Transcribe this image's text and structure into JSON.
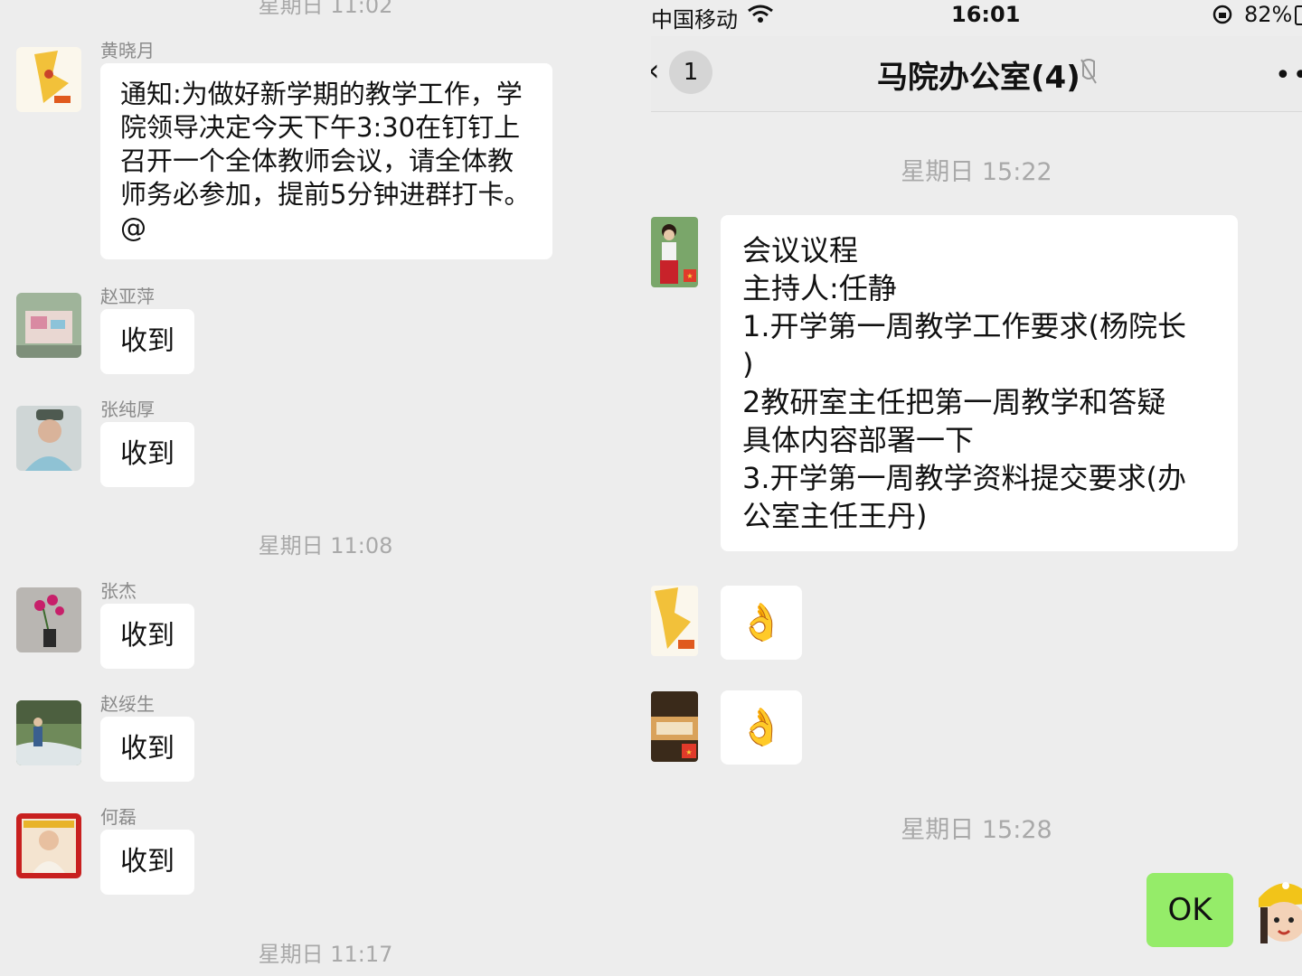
{
  "left": {
    "top_ts": "星期日 11:02",
    "messages": [
      {
        "sender": "黄晓月",
        "text": "通知:为做好新学期的教学工作，学院领导决定今天下午3:30在钉钉上召开一个全体教师会议，请全体教师务必参加，提前5分钟进群打卡。@"
      },
      {
        "sender": "赵亚萍",
        "text": "收到"
      },
      {
        "sender": "张纯厚",
        "text": "收到"
      },
      {
        "sender": "张杰",
        "text": "收到"
      },
      {
        "sender": "赵绥生",
        "text": "收到"
      },
      {
        "sender": "何磊",
        "text": "收到"
      }
    ],
    "ts1": "星期日 11:08",
    "ts2": "星期日 11:17"
  },
  "right": {
    "status": {
      "carrier": "中国移动",
      "time": "16:01",
      "battery": "82%"
    },
    "nav": {
      "back_count": "1",
      "title": "马院办公室(4)",
      "more": "••"
    },
    "ts1": "星期日 15:22",
    "agenda": [
      "会议议程",
      "主持人:任静",
      "1.开学第一周教学工作要求(杨院长",
      ")",
      "2教研室主任把第一周教学和答疑",
      "具体内容部署一下",
      "3.开学第一周教学资料提交要求(办",
      "公室主任王丹)"
    ],
    "emoji1": "👌",
    "emoji2": "👌",
    "ts2": "星期日 15:28",
    "self_msg": "OK"
  }
}
